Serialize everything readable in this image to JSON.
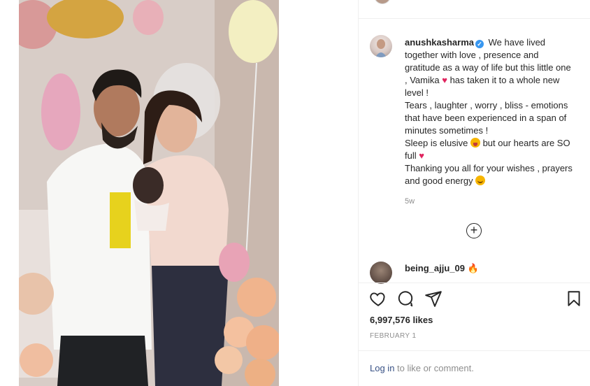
{
  "post": {
    "username": "anushkasharma",
    "caption_lines": [
      "We have lived together with love , presence and gratitude as a way of life but this little one , Vamika",
      "has taken it to a whole new level !",
      "Tears , laughter , worry , bliss - emotions that have been experienced in a span of minutes sometimes !",
      "Sleep is elusive",
      "but our hearts are SO full",
      "Thanking you all for your wishes , prayers and good energy"
    ],
    "time_ago": "5w",
    "likes": "6,997,576 likes",
    "date": "FEBRUARY 1"
  },
  "comment": {
    "username": "being_ajju_09"
  },
  "footer": {
    "login_link": "Log in",
    "login_text": " to like or comment."
  },
  "icons": {
    "verified": "verified-badge-icon",
    "heart_emoji": "red-heart-emoji",
    "tongue_emoji": "face-with-tongue-emoji",
    "smile_emoji": "smiling-face-emoji",
    "fire_emoji": "fire-emoji",
    "like": "heart-outline-icon",
    "comment": "speech-bubble-icon",
    "share": "paper-plane-icon",
    "save": "bookmark-icon",
    "load_more": "plus-circle-icon"
  },
  "colors": {
    "link": "#385185",
    "verified": "#3897f0",
    "muted": "#8e8e8e",
    "heart": "#e0245e"
  }
}
